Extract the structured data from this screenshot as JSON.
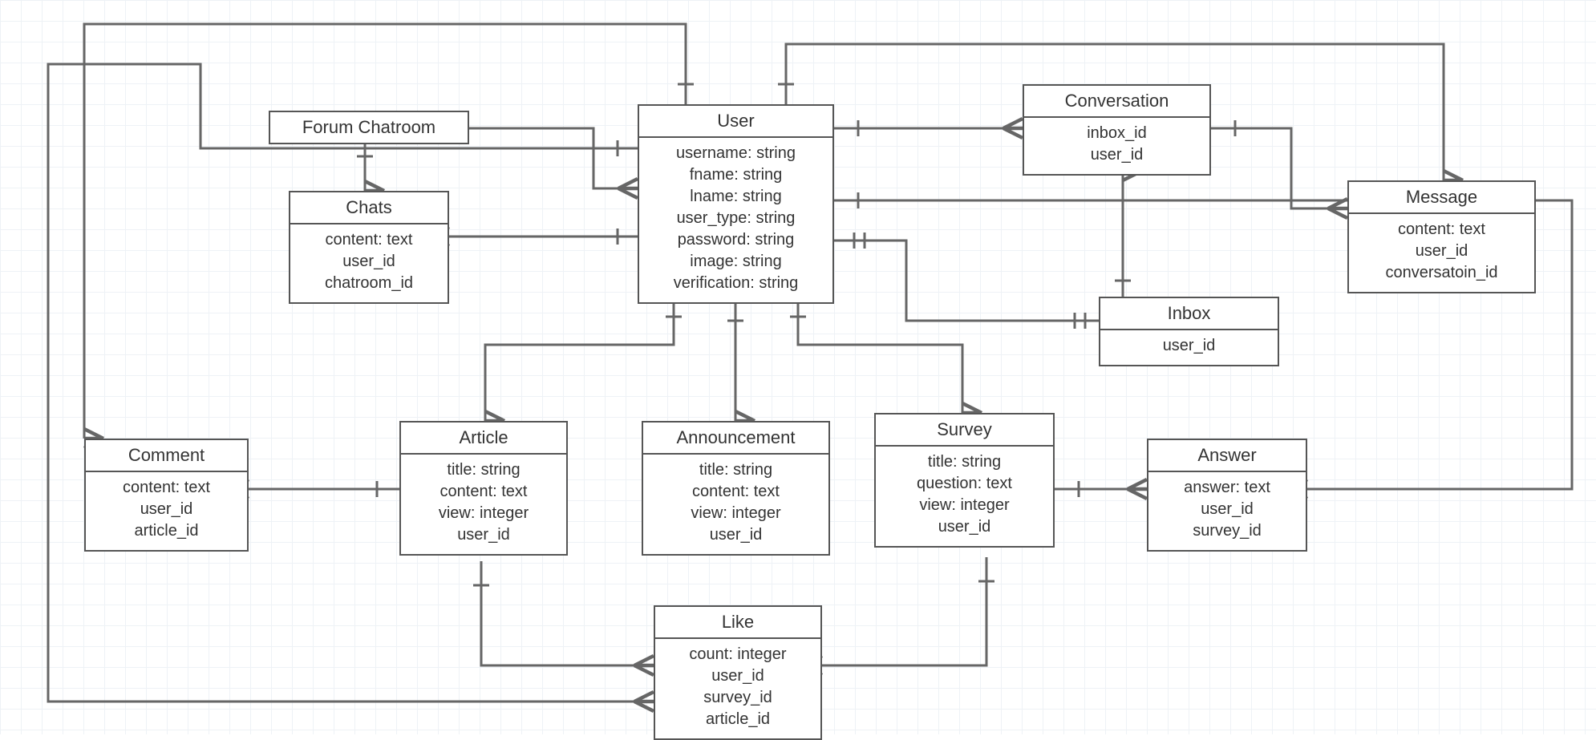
{
  "entities": {
    "forumChatroom": {
      "title": "Forum Chatroom"
    },
    "chats": {
      "title": "Chats",
      "attrs": [
        "content: text",
        "user_id",
        "chatroom_id"
      ]
    },
    "user": {
      "title": "User",
      "attrs": [
        "username: string",
        "fname: string",
        "lname: string",
        "user_type: string",
        "password: string",
        "image: string",
        "verification: string"
      ]
    },
    "conversation": {
      "title": "Conversation",
      "attrs": [
        "inbox_id",
        "user_id"
      ]
    },
    "message": {
      "title": "Message",
      "attrs": [
        "content: text",
        "user_id",
        "conversatoin_id"
      ]
    },
    "inbox": {
      "title": "Inbox",
      "attrs": [
        "user_id"
      ]
    },
    "comment": {
      "title": "Comment",
      "attrs": [
        "content: text",
        "user_id",
        "article_id"
      ]
    },
    "article": {
      "title": "Article",
      "attrs": [
        "title: string",
        "content: text",
        "view: integer",
        "user_id"
      ]
    },
    "announcement": {
      "title": "Announcement",
      "attrs": [
        "title: string",
        "content: text",
        "view: integer",
        "user_id"
      ]
    },
    "survey": {
      "title": "Survey",
      "attrs": [
        "title: string",
        "question: text",
        "view: integer",
        "user_id"
      ]
    },
    "answer": {
      "title": "Answer",
      "attrs": [
        "answer: text",
        "user_id",
        "survey_id"
      ]
    },
    "like": {
      "title": "Like",
      "attrs": [
        "count: integer",
        "user_id",
        "survey_id",
        "article_id"
      ]
    }
  },
  "relationships": [
    {
      "from": "ForumChatroom",
      "to": "Chats",
      "type": "one-to-many"
    },
    {
      "from": "ForumChatroom",
      "to": "User",
      "type": "association"
    },
    {
      "from": "User",
      "to": "Chats",
      "type": "one-to-many"
    },
    {
      "from": "User",
      "to": "Comment",
      "type": "one-to-many"
    },
    {
      "from": "User",
      "to": "Article",
      "type": "one-to-many"
    },
    {
      "from": "User",
      "to": "Announcement",
      "type": "one-to-many"
    },
    {
      "from": "User",
      "to": "Survey",
      "type": "one-to-many"
    },
    {
      "from": "User",
      "to": "Conversation",
      "type": "one-to-many"
    },
    {
      "from": "User",
      "to": "Inbox",
      "type": "one-to-one"
    },
    {
      "from": "User",
      "to": "Message",
      "type": "one-to-many"
    },
    {
      "from": "User",
      "to": "Answer",
      "type": "one-to-many"
    },
    {
      "from": "User",
      "to": "Like",
      "type": "one-to-many"
    },
    {
      "from": "Conversation",
      "to": "Message",
      "type": "one-to-many"
    },
    {
      "from": "Inbox",
      "to": "Conversation",
      "type": "one-to-many"
    },
    {
      "from": "Article",
      "to": "Comment",
      "type": "one-to-many"
    },
    {
      "from": "Article",
      "to": "Like",
      "type": "one-to-many"
    },
    {
      "from": "Survey",
      "to": "Answer",
      "type": "one-to-many"
    },
    {
      "from": "Survey",
      "to": "Like",
      "type": "one-to-many"
    }
  ]
}
